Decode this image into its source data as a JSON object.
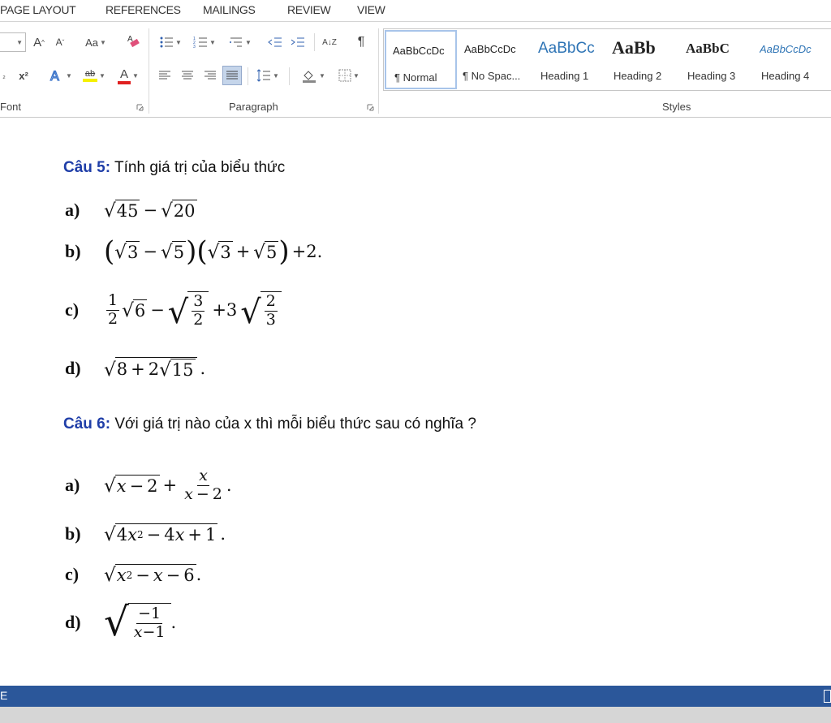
{
  "tabs": [
    "PAGE LAYOUT",
    "REFERENCES",
    "MAILINGS",
    "REVIEW",
    "VIEW"
  ],
  "font_group": {
    "label": "Font",
    "grow_font": "A",
    "shrink_font": "A",
    "change_case": "Aa",
    "superscript": "x²",
    "highlight": "ab",
    "font_color": "A"
  },
  "paragraph_group": {
    "label": "Paragraph",
    "sort": "A↓Z",
    "pilcrow": "¶"
  },
  "styles_group": {
    "label": "Styles",
    "items": [
      {
        "preview": "AaBbCcDc",
        "name": "¶ Normal"
      },
      {
        "preview": "AaBbCcDc",
        "name": "¶ No Spac..."
      },
      {
        "preview": "AaBbCc",
        "name": "Heading 1"
      },
      {
        "preview": "AaBb",
        "name": "Heading 2"
      },
      {
        "preview": "AaBbC",
        "name": "Heading 3"
      },
      {
        "preview": "AaBbCcDc",
        "name": "Heading 4"
      }
    ]
  },
  "document": {
    "q5": {
      "label": "Câu 5:",
      "text": "Tính giá trị của biểu thức",
      "items": {
        "a": {
          "label": "a)",
          "r1": "45",
          "op": "−",
          "r2": "20"
        },
        "b": {
          "label": "b)",
          "r1": "3",
          "op1": "−",
          "r2": "5",
          "r3": "3",
          "op2": "+",
          "r4": "5",
          "tail": "+2."
        },
        "c": {
          "label": "c)",
          "f1n": "1",
          "f1d": "2",
          "r1": "6",
          "op1": "−",
          "f2n": "3",
          "f2d": "2",
          "op2": "+3",
          "f3n": "2",
          "f3d": "3"
        },
        "d": {
          "label": "d)",
          "a": "8",
          "op": "+",
          "b": "2",
          "inner": "15",
          "tail": "."
        }
      }
    },
    "q6": {
      "label": "Câu 6:",
      "text": "Với giá trị nào của x thì mỗi biểu thức sau có nghĩa ?",
      "items": {
        "a": {
          "label": "a)",
          "x": "x",
          "op": "−",
          "two": "2",
          "plus": "+",
          "fn": "x",
          "fdx": "x",
          "fdop": "−",
          "fd2": "2",
          "tail": "."
        },
        "b": {
          "label": "b)",
          "c1": "4",
          "x1": "x",
          "exp": "2",
          "op1": "−",
          "c2": "4",
          "x2": "x",
          "op2": "+",
          "c3": "1",
          "tail": "."
        },
        "c": {
          "label": "c)",
          "x1": "x",
          "exp": "2",
          "op1": "−",
          "x2": "x",
          "op2": "−",
          "c": "6",
          "tail": "."
        },
        "d": {
          "label": "d)",
          "num": "−1",
          "dx": "x",
          "dop": "−",
          "d1": "1",
          "tail": "."
        }
      }
    }
  },
  "status": {
    "left": "E"
  }
}
